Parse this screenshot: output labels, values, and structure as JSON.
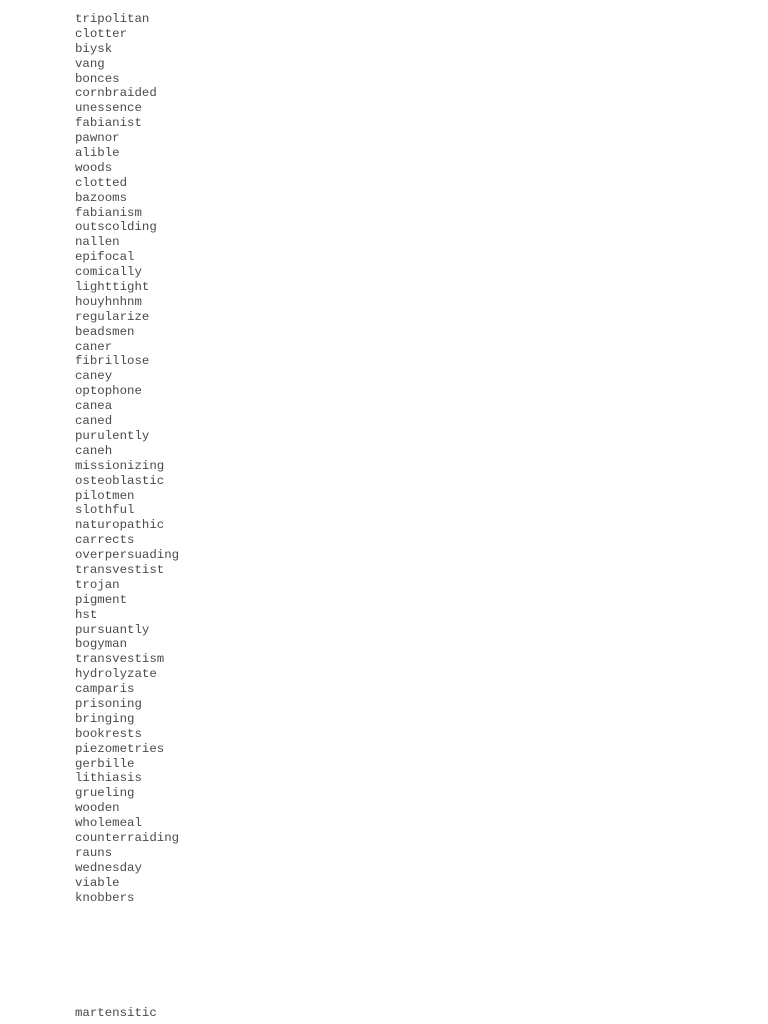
{
  "words": [
    "tripolitan",
    "clotter",
    "biysk",
    "vang",
    "bonces",
    "cornbraided",
    "unessence",
    "fabianist",
    "pawnor",
    "alible",
    "woods",
    "clotted",
    "bazooms",
    "fabianism",
    "outscolding",
    "nallen",
    "epifocal",
    "comically",
    "lighttight",
    "houyhnhnm",
    "regularize",
    "beadsmen",
    "caner",
    "fibrillose",
    "caney",
    "optophone",
    "canea",
    "caned",
    "purulently",
    "caneh",
    "missionizing",
    "osteoblastic",
    "pilotmen",
    "slothful",
    "naturopathic",
    "carrects",
    "overpersuading",
    "transvestist",
    "trojan",
    "pigment",
    "hst",
    "pursuantly",
    "bogyman",
    "transvestism",
    "hydrolyzate",
    "camparis",
    "prisoning",
    "bringing",
    "bookrests",
    "piezometries",
    "gerbille",
    "lithiasis",
    "grueling",
    "wooden",
    "wholemeal",
    "counterraiding",
    "rauns",
    "wednesday",
    "viable",
    "knobbers"
  ],
  "footer_word": "martensitic"
}
